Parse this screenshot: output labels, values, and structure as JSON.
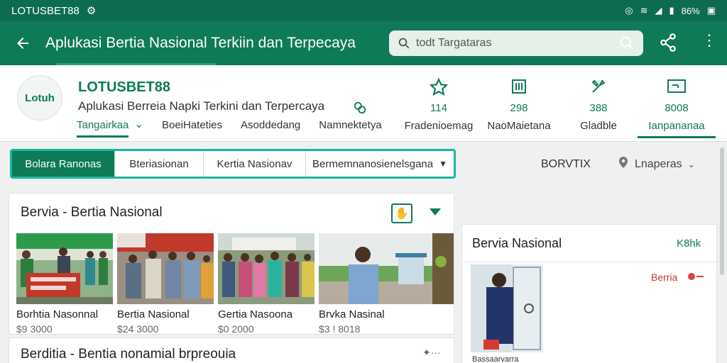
{
  "status_bar": {
    "carrier": "LOTUSBET88",
    "right_text": "86%"
  },
  "app_bar": {
    "title": "Aplukasi Bertia Nasional Terkiin dan Terpecaya",
    "search_placeholder": "todt Targataras"
  },
  "profile": {
    "brand": "LOTUSBET88",
    "logo_text": "Lotuh",
    "tagline": "Aplukasi Berreia Napki Terkini dan Terpercaya",
    "subtabs": [
      {
        "label": "Tangairkaa",
        "active": true
      },
      {
        "label": "BoeiHateties",
        "active": false
      },
      {
        "label": "Asoddedang",
        "active": false
      },
      {
        "label": "Namnektetya",
        "active": false
      }
    ],
    "stats": [
      {
        "icon": "star-icon",
        "num": "114",
        "label": "Fradenioemag"
      },
      {
        "icon": "calendar-icon",
        "num": "298",
        "label": "NaoMaietana"
      },
      {
        "icon": "tools-icon",
        "num": "388",
        "label": "Gladble"
      },
      {
        "icon": "monitor-icon",
        "num": "8008",
        "label": "Ianpananaa",
        "active": true
      }
    ]
  },
  "filters": {
    "tabs": [
      {
        "label": "Bolara Ranonas",
        "active": true
      },
      {
        "label": "Bteriasionan",
        "active": false
      },
      {
        "label": "Kertia Nasionav",
        "active": false
      },
      {
        "label": "Bermemnanosienelsgana",
        "active": false,
        "dropdown": true
      }
    ],
    "sort_label": "BORVTIX",
    "location_label": "Lnaperas"
  },
  "news_card": {
    "title": "Bervia - Bertia Nasional",
    "items": [
      {
        "caption": "Borhtia Nasonnal",
        "price": "$9 3000"
      },
      {
        "caption": "Bertia Nasional",
        "price": "$24 3000"
      },
      {
        "caption": "Gertia Nasoona",
        "price": "$0 2000"
      },
      {
        "caption": "Brvka Nasinal",
        "price": "$3 ! 8018"
      }
    ]
  },
  "list_item": {
    "title": "Berditia - Bentia nonamial brpreouia"
  },
  "side_panel": {
    "title": "Bervia Nasional",
    "link": "K8hk",
    "badge": "Berria",
    "photo_caption": "Bassaarvarra"
  },
  "colors": {
    "primary": "#0e7a58",
    "status_bar": "#0d6b4f",
    "accent_border": "#18b5a5",
    "badge_red": "#c0392b"
  }
}
